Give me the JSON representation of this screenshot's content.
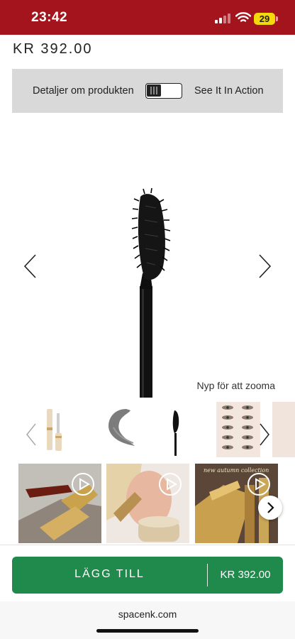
{
  "status_bar": {
    "time": "23:42",
    "battery_level": "29",
    "background": "#a3141c"
  },
  "product": {
    "price": "KR 392.00"
  },
  "toggle": {
    "left_label": "Detaljer om produkten",
    "right_label": "See It In Action",
    "state": "off"
  },
  "viewer": {
    "zoom_hint": "Nyp för att zooma",
    "icons": [
      "chevron-left-icon",
      "chevron-right-icon"
    ]
  },
  "thumbnails": [
    {
      "name": "mascara-tube-thumbnail",
      "selected": false
    },
    {
      "name": "product-swatch-thumbnail",
      "selected": false
    },
    {
      "name": "mascara-wand-thumbnail",
      "selected": true
    },
    {
      "name": "eye-results-thumbnail",
      "selected": false
    }
  ],
  "videos": [
    {
      "name": "mascara-closeup-video",
      "caption": ""
    },
    {
      "name": "model-application-video",
      "caption": ""
    },
    {
      "name": "autumn-collection-video",
      "caption": "new autumn collection"
    }
  ],
  "cart": {
    "add_label": "LÄGG TILL",
    "price": "KR 392.00",
    "button_color": "#1f8a4c"
  },
  "browser": {
    "url": "spacenk.com"
  }
}
